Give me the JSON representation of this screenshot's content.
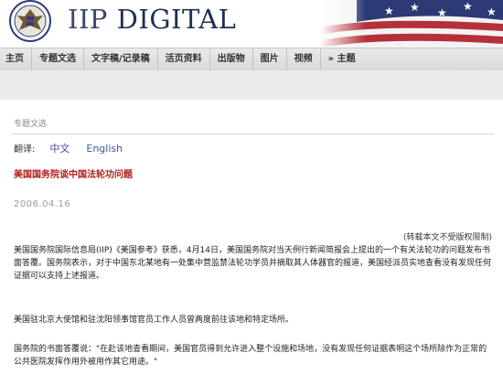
{
  "header": {
    "site_title_part1": "IIP",
    "site_title_part2": "DIGITAL",
    "seal_icon": "us-department-of-state-seal-icon",
    "flag_icon": "american-flag-icon",
    "seal_color": "#2c3f7a",
    "flag_red": "#b5313a",
    "flag_blue": "#2b3a73"
  },
  "nav": {
    "items": [
      "主页",
      "专题文选",
      "文字稿/记录稿",
      "活页资料",
      "出版物",
      "图片",
      "视频",
      "» 主题"
    ]
  },
  "page": {
    "section_label": "专题文选",
    "translate_label": "翻译:",
    "lang_zh": "中文",
    "lang_en": "English",
    "article_title": "美国国务院谈中国法轮功问题",
    "date": "2006.04.16",
    "copyright_note": "(转载本文不受版权限制)",
    "paragraphs": [
      "美国国务院国际信息局(IIP)《美国参考》获悉，4月14日，美国国务院对当天例行新闻简报会上提出的一个有关法轮功的问题发布书面答覆。国务院表示，对于中国东北某地有一处集中营监禁法轮功学员并摘取其人体器官的报道，美国经派员实地查看没有发现任何证据可以支持上述报道。",
      "美国驻北京大使馆和驻沈阳领事馆官员工作人员曾两度前往该地和特定场所。",
      "国务院的书面答覆说：\"在赴该地查看期间，美国官员得到允许进入整个设施和场地，没有发现任何证据表明这个场所除作为正常的公共医院发挥作用外被用作其它用途。\""
    ]
  },
  "colors": {
    "title_red": "#b0201c",
    "link_blue": "#3d55a8",
    "nav_bg": "#e2e2e2"
  }
}
